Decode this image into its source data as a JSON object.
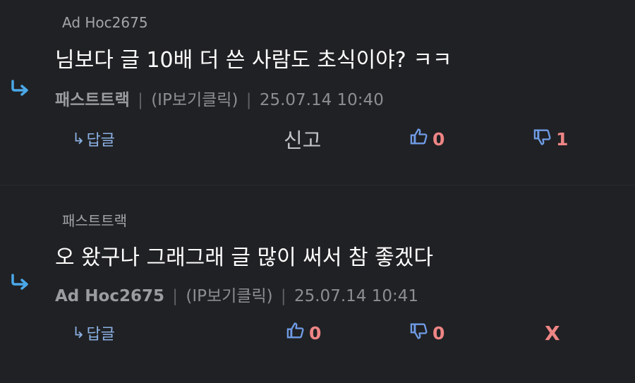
{
  "colors": {
    "background": "#202124",
    "reply_arrow": "#4aa8e8",
    "link_blue": "#8bb1e5",
    "thumb_blue": "#6f9ce6",
    "count_red": "#ee8585"
  },
  "comments": [
    {
      "reply_to": "Ad Hoc2675",
      "text": "님보다 글 10배 더 쓴 사람도 초식이야? ㅋㅋ",
      "author": "패스트트랙",
      "ip_label": "(IP보기클릭)",
      "datetime": "25.07.14 10:40",
      "reply_label": "답글",
      "report_label": "신고",
      "like_count": "0",
      "dislike_count": "1"
    },
    {
      "reply_to": "패스트트랙",
      "text": "오 왔구나 그래그래 글 많이 써서 참 좋겠다",
      "author": "Ad Hoc2675",
      "ip_label": "(IP보기클릭)",
      "datetime": "25.07.14 10:41",
      "reply_label": "답글",
      "like_count": "0",
      "dislike_count": "0",
      "delete_label": "X"
    }
  ],
  "icons": {
    "reply_indent": "reply-arrow-icon",
    "like": "thumbs-up-icon",
    "dislike": "thumbs-down-icon"
  },
  "separator": "|",
  "reply_glyph": "↳"
}
